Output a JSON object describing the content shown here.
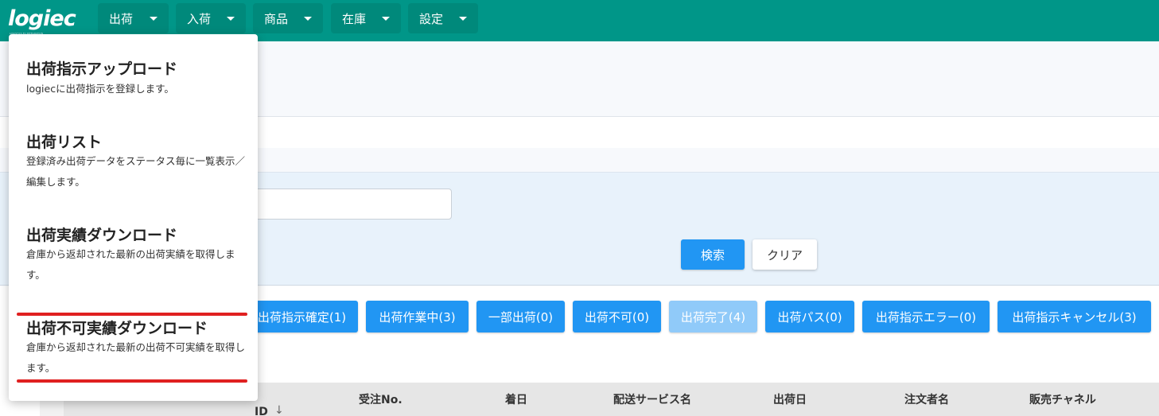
{
  "app": {
    "logo": "logiec",
    "logo_tagline": "LOGISTICS EC INTEGRATION"
  },
  "nav": [
    {
      "label": "出荷"
    },
    {
      "label": "入荷"
    },
    {
      "label": "商品"
    },
    {
      "label": "在庫"
    },
    {
      "label": "設定"
    }
  ],
  "dropdown": {
    "items": [
      {
        "title": "出荷指示アップロード",
        "description": "logiecに出荷指示を登録します。"
      },
      {
        "title": "出荷リスト",
        "description": "登録済み出荷データをステータス毎に一覧表示／編集します。"
      },
      {
        "title": "出荷実績ダウンロード",
        "description": "倉庫から返却された最新の出荷実績を取得します。"
      },
      {
        "title": "出荷不可実績ダウンロード",
        "description": "倉庫から返却された最新の出荷不可実績を取得します。"
      }
    ]
  },
  "search": {
    "search_label": "検索",
    "clear_label": "クリア"
  },
  "status_buttons": [
    {
      "label": "出荷指示確定(1)"
    },
    {
      "label": "出荷作業中(3)"
    },
    {
      "label": "一部出荷(0)"
    },
    {
      "label": "出荷不可(0)"
    },
    {
      "label": "出荷完了(4)"
    },
    {
      "label": "出荷パス(0)"
    },
    {
      "label": "出荷指示エラー(0)"
    },
    {
      "label": "出荷指示キャンセル(3)"
    }
  ],
  "table": {
    "columns": [
      "ID",
      "受注No.",
      "着日",
      "配送サービス名",
      "出荷日",
      "注文者名",
      "販売チャネル"
    ]
  },
  "colors": {
    "topbar": "#009688",
    "nav_button": "#00897b",
    "primary": "#2196f3",
    "primary_disabled": "#90caf9",
    "annotation": "#e02020"
  }
}
